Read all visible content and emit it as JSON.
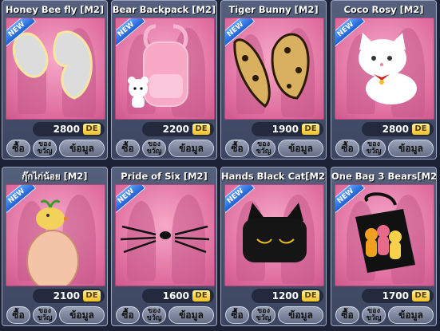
{
  "badge": "NEW",
  "currency": "DE",
  "buttons": {
    "buy": "ซื้อ",
    "gift": "ของ ขวัญ",
    "info": "ข้อมูล"
  },
  "items": [
    {
      "name": "Honey Bee fly [M2]",
      "price": "2800",
      "icon": "wings-icon"
    },
    {
      "name": "Bear Backpack [M2]",
      "price": "2200",
      "icon": "backpack-icon"
    },
    {
      "name": "Tiger Bunny [M2]",
      "price": "1900",
      "icon": "bunny-ears-icon"
    },
    {
      "name": "Coco Rosy [M2]",
      "price": "2800",
      "icon": "cat-icon"
    },
    {
      "name": "กุ๊กไก่น้อย [M2]",
      "price": "2100",
      "icon": "chick-icon"
    },
    {
      "name": "Pride of Six [M2]",
      "price": "1600",
      "icon": "whiskers-icon"
    },
    {
      "name": "Hands Black Cat[M2]",
      "price": "1200",
      "icon": "cat-bag-icon"
    },
    {
      "name": "One Bag 3 Bears[M2]",
      "price": "1700",
      "icon": "bear-bag-icon"
    }
  ]
}
